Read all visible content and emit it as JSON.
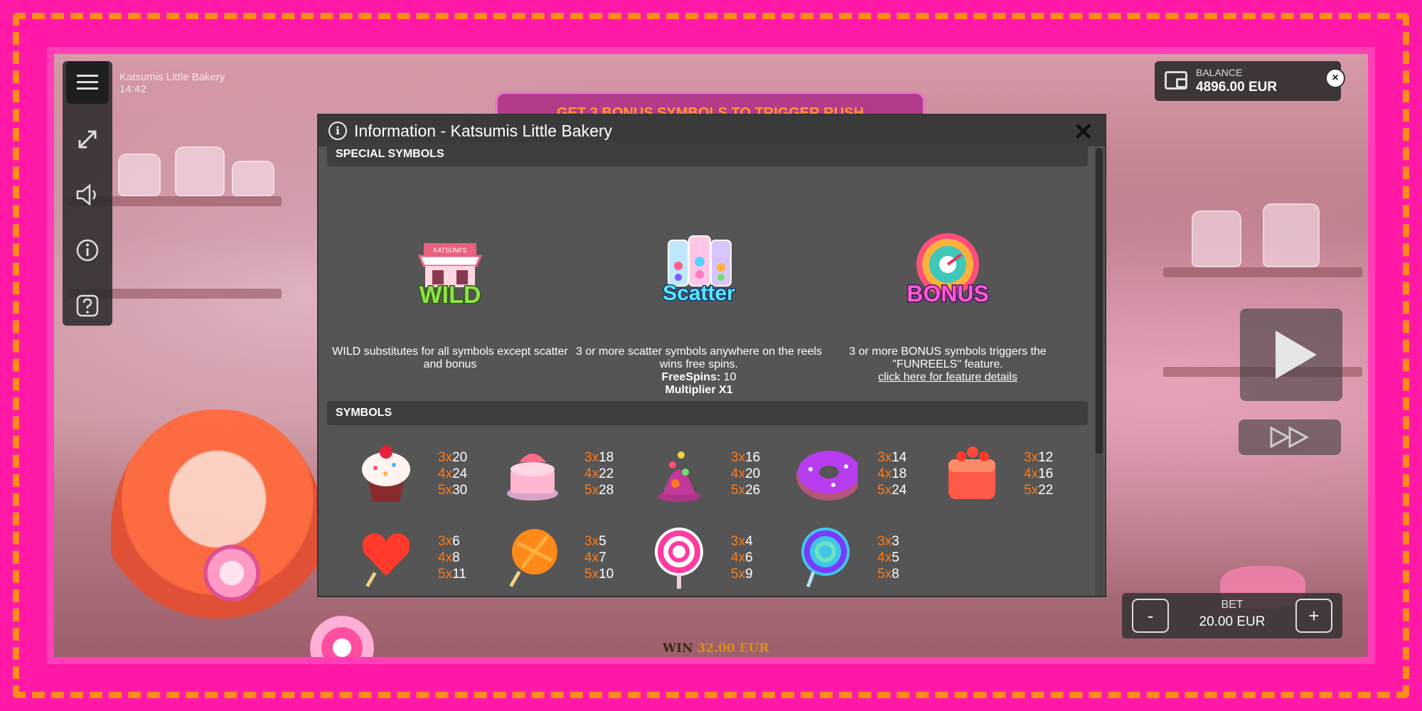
{
  "game": {
    "title": "Katsumis Little Bakery",
    "clock": "14:42",
    "banner_text": "GET 3 BONUS SYMBOLS TO TRIGGER RUSH"
  },
  "balance": {
    "label": "BALANCE",
    "value": "4896.00 EUR"
  },
  "bet": {
    "label": "BET",
    "value": "20.00 EUR",
    "minus": "-",
    "plus": "+"
  },
  "win": {
    "label": "WIN",
    "value": "32.00 EUR"
  },
  "close_small": "×",
  "modal": {
    "title": "Information - Katsumis Little Bakery",
    "info_glyph": "i",
    "close": "✕",
    "special_header": "SPECIAL SYMBOLS",
    "symbols_header": "SYMBOLS",
    "special": [
      {
        "name": "WILD",
        "desc": "WILD substitutes for all symbols except scatter and bonus"
      },
      {
        "name": "Scatter",
        "desc": "3 or more scatter symbols anywhere on the reels wins free spins.",
        "free_spins_label": "FreeSpins:",
        "free_spins_value": "10",
        "multiplier": "Multiplier X1"
      },
      {
        "name": "BONUS",
        "desc": "3 or more BONUS symbols triggers the \"FUNREELS\" feature.",
        "link": "click here for feature details"
      }
    ],
    "paytable": [
      {
        "symbol": "cupcake",
        "pays": [
          [
            "3x",
            "20"
          ],
          [
            "4x",
            "24"
          ],
          [
            "5x",
            "30"
          ]
        ]
      },
      {
        "symbol": "cake",
        "pays": [
          [
            "3x",
            "18"
          ],
          [
            "4x",
            "22"
          ],
          [
            "5x",
            "28"
          ]
        ]
      },
      {
        "symbol": "candy-tower",
        "pays": [
          [
            "3x",
            "16"
          ],
          [
            "4x",
            "20"
          ],
          [
            "5x",
            "26"
          ]
        ]
      },
      {
        "symbol": "donut",
        "pays": [
          [
            "3x",
            "14"
          ],
          [
            "4x",
            "18"
          ],
          [
            "5x",
            "24"
          ]
        ]
      },
      {
        "symbol": "jelly-cube",
        "pays": [
          [
            "3x",
            "12"
          ],
          [
            "4x",
            "16"
          ],
          [
            "5x",
            "22"
          ]
        ]
      },
      {
        "symbol": "heart-lollipop",
        "pays": [
          [
            "3x",
            "6"
          ],
          [
            "4x",
            "8"
          ],
          [
            "5x",
            "11"
          ]
        ]
      },
      {
        "symbol": "orange-lollipop",
        "pays": [
          [
            "3x",
            "5"
          ],
          [
            "4x",
            "7"
          ],
          [
            "5x",
            "10"
          ]
        ]
      },
      {
        "symbol": "pink-swirl-lollipop",
        "pays": [
          [
            "3x",
            "4"
          ],
          [
            "4x",
            "6"
          ],
          [
            "5x",
            "9"
          ]
        ]
      },
      {
        "symbol": "blue-swirl-lollipop",
        "pays": [
          [
            "3x",
            "3"
          ],
          [
            "4x",
            "5"
          ],
          [
            "5x",
            "8"
          ]
        ]
      }
    ]
  },
  "icons": {
    "menu": "hamburger-icon",
    "fullscreen": "fullscreen-icon",
    "sound": "speaker-icon",
    "info": "info-icon",
    "help": "help-icon",
    "wallet": "wallet-icon",
    "play": "play-icon",
    "fast_forward": "fast-forward-icon"
  },
  "colors": {
    "frame": "#ff19a6",
    "dash": "#ff8c1a",
    "pay_multiplier": "#ff7a1a",
    "modal_bg": "#555555"
  }
}
